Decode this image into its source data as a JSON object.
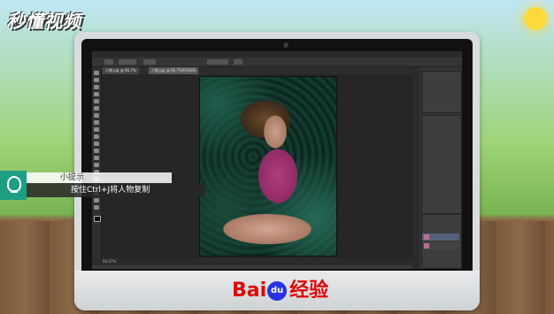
{
  "branding": {
    "top_logo": "秒懂视频",
    "baidu_left": "Bai",
    "baidu_paw": "du",
    "baidu_right": "经验"
  },
  "photoshop": {
    "tabs": [
      "人物.jpg @ 66.7%",
      "人物.jpg @ 66.7%(RGB/8)"
    ],
    "status": "66.67%"
  },
  "tip": {
    "title": "小提示",
    "text": "按住Ctrl+J将人物复制"
  },
  "colors": {
    "accent": "#1e9e84",
    "baidu_red": "#e10602",
    "baidu_blue": "#2932e1"
  }
}
